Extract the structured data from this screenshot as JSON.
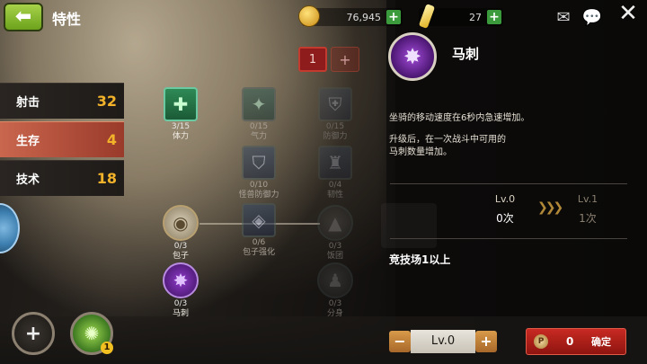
{
  "header": {
    "title": "特性",
    "gold": "76,945",
    "gems": "27",
    "page_tabs": [
      "1",
      "+"
    ]
  },
  "categories": [
    {
      "label": "射击",
      "value": "32",
      "active": false
    },
    {
      "label": "生存",
      "value": "4",
      "active": true
    },
    {
      "label": "技术",
      "value": "18",
      "active": false
    }
  ],
  "skills": {
    "s1": {
      "count": "3/15",
      "name": "体力"
    },
    "s2": {
      "count": "0/15",
      "name": "气力"
    },
    "s3": {
      "count": "0/15",
      "name": "防御力"
    },
    "s4": {
      "count": "0/10",
      "name": "怪兽防御力"
    },
    "s5": {
      "count": "0/4",
      "name": "韧性"
    },
    "s6": {
      "count": "0/3",
      "name": "包子"
    },
    "s7": {
      "count": "0/6",
      "name": "包子强化"
    },
    "s8": {
      "count": "0/3",
      "name": "饭团"
    },
    "s9": {
      "count": "0/3",
      "name": "马刺"
    },
    "s10": {
      "count": "0/3",
      "name": "分身"
    }
  },
  "detail": {
    "name": "马刺",
    "desc1": "坐骑的移动速度在6秒内急速增加。",
    "desc2_line1": "升级后，在一次战斗中可用的",
    "desc2_line2": "马刺数量增加。",
    "current_level": "Lv.0",
    "current_value": "0次",
    "next_level": "Lv.1",
    "next_value": "1次",
    "requirement": "竞技场1以上"
  },
  "footer": {
    "special_badge": "1",
    "level_value": "Lv.0",
    "confirm_cost": "0",
    "confirm_label": "确定",
    "p_icon": "P"
  },
  "colors": {
    "accent_orange": "#f2b32a",
    "confirm_red": "#c82a22",
    "back_green": "#8cc23a"
  }
}
